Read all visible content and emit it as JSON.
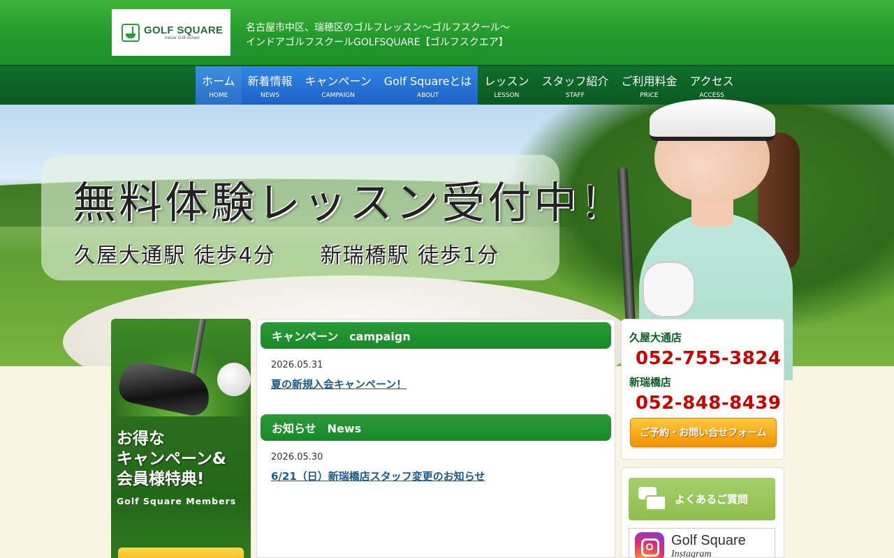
{
  "header": {
    "logo_main": "GOLF SQUARE",
    "logo_sub": "Indoor Golf School",
    "tagline_line1": "名古屋市中区、瑞穂区のゴルフレッスン〜ゴルフスクール〜",
    "tagline_line2": "インドアゴルフスクールGOLFSQUARE【ゴルフスクエア】"
  },
  "nav": {
    "items": [
      {
        "ja": "ホーム",
        "en": "HOME"
      },
      {
        "ja": "新着情報",
        "en": "NEWS"
      },
      {
        "ja": "キャンペーン",
        "en": "CAMPAIGN"
      },
      {
        "ja": "Golf Squareとは",
        "en": "ABOUT"
      },
      {
        "ja": "レッスン",
        "en": "LESSON"
      },
      {
        "ja": "スタッフ紹介",
        "en": "STAFF"
      },
      {
        "ja": "ご利用料金",
        "en": "PRICE"
      },
      {
        "ja": "アクセス",
        "en": "ACCESS"
      }
    ]
  },
  "hero": {
    "title": "無料体験レッスン受付中！",
    "station1": "久屋大通駅 徒歩4分",
    "station2": "新瑞橋駅 徒歩1分"
  },
  "left_ad": {
    "title_line1": "お得な",
    "title_line2": "キャンペーン&",
    "title_line3": "会員様特典!",
    "subtitle": "Golf Square Members"
  },
  "campaign": {
    "heading": "キャンペーン　campaign",
    "date": "2026.05.31",
    "link": "夏の新規入会キャンペーン！"
  },
  "news": {
    "heading": "お知らせ　News",
    "date": "2026.05.30",
    "link": "6/21（日）新瑞橋店スタッフ変更のお知らせ"
  },
  "contact": {
    "shop1_name": "久屋大通店",
    "shop1_tel": "052-755-3824",
    "shop2_name": "新瑞橋店",
    "shop2_tel": "052-848-8439",
    "form_button": "ご予約・お問い合せフォーム"
  },
  "sidebar": {
    "faq_label": "よくあるご質問",
    "instagram_main": "Golf Square",
    "instagram_sub": "Instagram"
  },
  "colors": {
    "header_green": "#21982a",
    "nav_dark_green": "#0f6e2c",
    "nav_active_blue": "#2a6fc8",
    "section_green": "#178a28",
    "tel_red": "#c80000",
    "form_orange": "#f29200",
    "faq_green": "#8fbf4f"
  }
}
